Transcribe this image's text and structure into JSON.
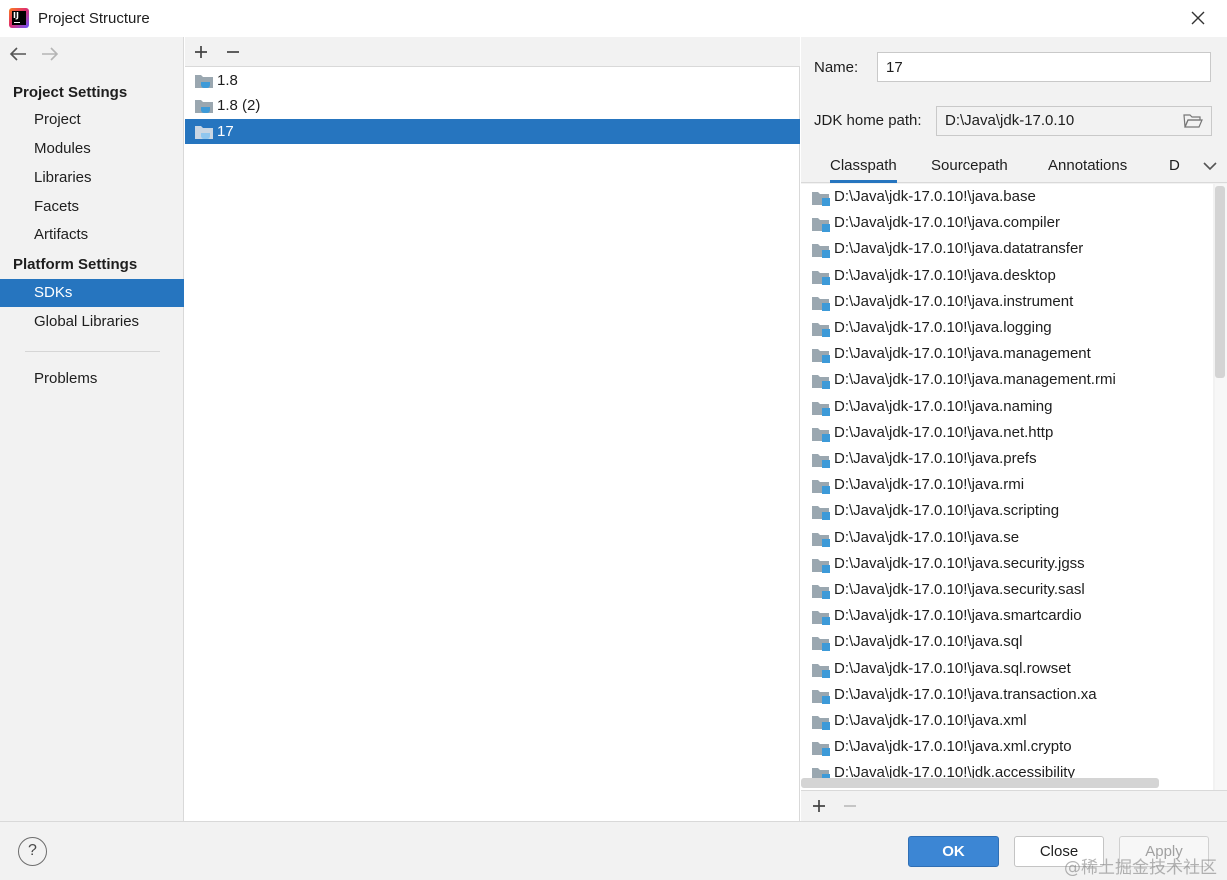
{
  "window": {
    "title": "Project Structure"
  },
  "left_nav": {
    "project_settings_header": "Project Settings",
    "project_settings_items": [
      "Project",
      "Modules",
      "Libraries",
      "Facets",
      "Artifacts"
    ],
    "platform_settings_header": "Platform Settings",
    "platform_settings_items": [
      "SDKs",
      "Global Libraries"
    ],
    "selected_item": "SDKs",
    "problems_label": "Problems"
  },
  "sdk_list": {
    "items": [
      "1.8",
      "1.8 (2)",
      "17"
    ],
    "selected_item": "17"
  },
  "details": {
    "name_label": "Name:",
    "name_value": "17",
    "jdk_home_label": "JDK home path:",
    "jdk_home_value": "D:\\Java\\jdk-17.0.10",
    "tabs": [
      "Classpath",
      "Sourcepath",
      "Annotations",
      "D"
    ],
    "active_tab": "Classpath",
    "classpath_entries": [
      "D:\\Java\\jdk-17.0.10!\\java.base",
      "D:\\Java\\jdk-17.0.10!\\java.compiler",
      "D:\\Java\\jdk-17.0.10!\\java.datatransfer",
      "D:\\Java\\jdk-17.0.10!\\java.desktop",
      "D:\\Java\\jdk-17.0.10!\\java.instrument",
      "D:\\Java\\jdk-17.0.10!\\java.logging",
      "D:\\Java\\jdk-17.0.10!\\java.management",
      "D:\\Java\\jdk-17.0.10!\\java.management.rmi",
      "D:\\Java\\jdk-17.0.10!\\java.naming",
      "D:\\Java\\jdk-17.0.10!\\java.net.http",
      "D:\\Java\\jdk-17.0.10!\\java.prefs",
      "D:\\Java\\jdk-17.0.10!\\java.rmi",
      "D:\\Java\\jdk-17.0.10!\\java.scripting",
      "D:\\Java\\jdk-17.0.10!\\java.se",
      "D:\\Java\\jdk-17.0.10!\\java.security.jgss",
      "D:\\Java\\jdk-17.0.10!\\java.security.sasl",
      "D:\\Java\\jdk-17.0.10!\\java.smartcardio",
      "D:\\Java\\jdk-17.0.10!\\java.sql",
      "D:\\Java\\jdk-17.0.10!\\java.sql.rowset",
      "D:\\Java\\jdk-17.0.10!\\java.transaction.xa",
      "D:\\Java\\jdk-17.0.10!\\java.xml",
      "D:\\Java\\jdk-17.0.10!\\java.xml.crypto",
      "D:\\Java\\jdk-17.0.10!\\jdk.accessibility"
    ]
  },
  "footer": {
    "help_label": "?",
    "ok_label": "OK",
    "close_label": "Close",
    "apply_label": "Apply",
    "watermark": "@稀土掘金技术社区"
  },
  "colors": {
    "selection": "#2675bf",
    "ok_button": "#3c86d4",
    "panel_bg": "#f2f2f2",
    "jar_accent": "#3d9ad8"
  }
}
